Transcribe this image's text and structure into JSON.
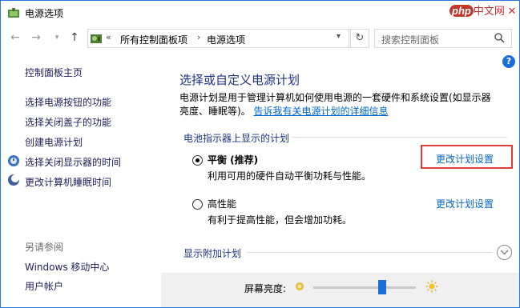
{
  "window": {
    "title": "电源选项",
    "icon": "power-options-icon"
  },
  "watermark": {
    "text_php": "php",
    "text_cn": "中文网"
  },
  "nav": {
    "address_path": [
      "所有控制面板项",
      "电源选项"
    ],
    "search_placeholder": "搜索控制面板",
    "address_chevrons": "«",
    "sep": "›"
  },
  "sidebar": {
    "home": "控制面板主页",
    "links": [
      "选择电源按钮的功能",
      "选择关闭盖子的功能",
      "创建电源计划",
      "选择关闭显示器的时间",
      "更改计算机睡眠时间"
    ],
    "see_also_title": "另请参阅",
    "see_also": [
      "Windows 移动中心",
      "用户帐户"
    ]
  },
  "main": {
    "help": "?",
    "heading": "选择或自定义电源计划",
    "description": "电源计划是用于管理计算机如何使用电源的一套硬件和系统设置(如显示器亮度、睡眠等)。",
    "description_link": "告诉我有关电源计划的详细信息",
    "section_title": "电池指示器上显示的计划",
    "plans": [
      {
        "name": "平衡 (推荐)",
        "desc": "利用可用的硬件自动平衡功耗与性能。",
        "link": "更改计划设置",
        "selected": true
      },
      {
        "name": "高性能",
        "desc": "有利于提高性能，但会增加功耗。",
        "link": "更改计划设置",
        "selected": false
      }
    ],
    "more_plans": "显示附加计划"
  },
  "brightness": {
    "label": "屏幕亮度:",
    "level": 0.67
  },
  "colors": {
    "accent": "#1a6ed8",
    "highlight": "#e53935",
    "link": "#0066cc",
    "heading": "#1e3287"
  }
}
